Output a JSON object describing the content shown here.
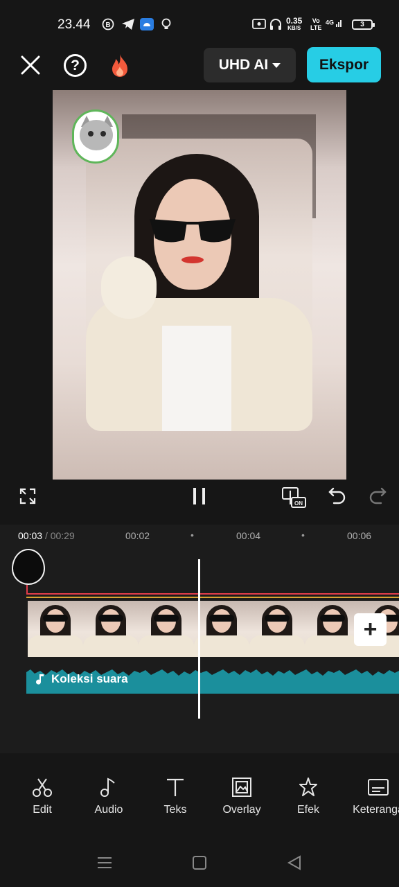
{
  "status_bar": {
    "time": "23.44",
    "net_speed_value": "0.35",
    "net_speed_unit": "KB/S",
    "volte_top": "Vo",
    "volte_bottom": "LTE",
    "signal_label": "4G",
    "battery_level": "3"
  },
  "toolbar": {
    "quality_label": "UHD AI",
    "export_label": "Ekspor"
  },
  "timeline": {
    "current_time": "00:03",
    "total_time": "/ 00:29",
    "ruler_marks": [
      "00:02",
      "00:04",
      "00:06"
    ],
    "ruler_dot": "•",
    "audio_track_label": "Koleksi suara",
    "add_clip_label": "+"
  },
  "tools": [
    {
      "label": "Edit",
      "icon": "scissors-icon"
    },
    {
      "label": "Audio",
      "icon": "music-note-icon"
    },
    {
      "label": "Teks",
      "icon": "text-icon"
    },
    {
      "label": "Overlay",
      "icon": "overlay-image-icon"
    },
    {
      "label": "Efek",
      "icon": "sparkle-star-icon"
    },
    {
      "label": "Keteranga",
      "icon": "captions-icon"
    }
  ],
  "colors": {
    "accent": "#27cde5",
    "background": "#161616",
    "audio_wave": "#1b8f9c",
    "marker_red": "#e33d4a",
    "marker_yellow": "#d9a332"
  }
}
